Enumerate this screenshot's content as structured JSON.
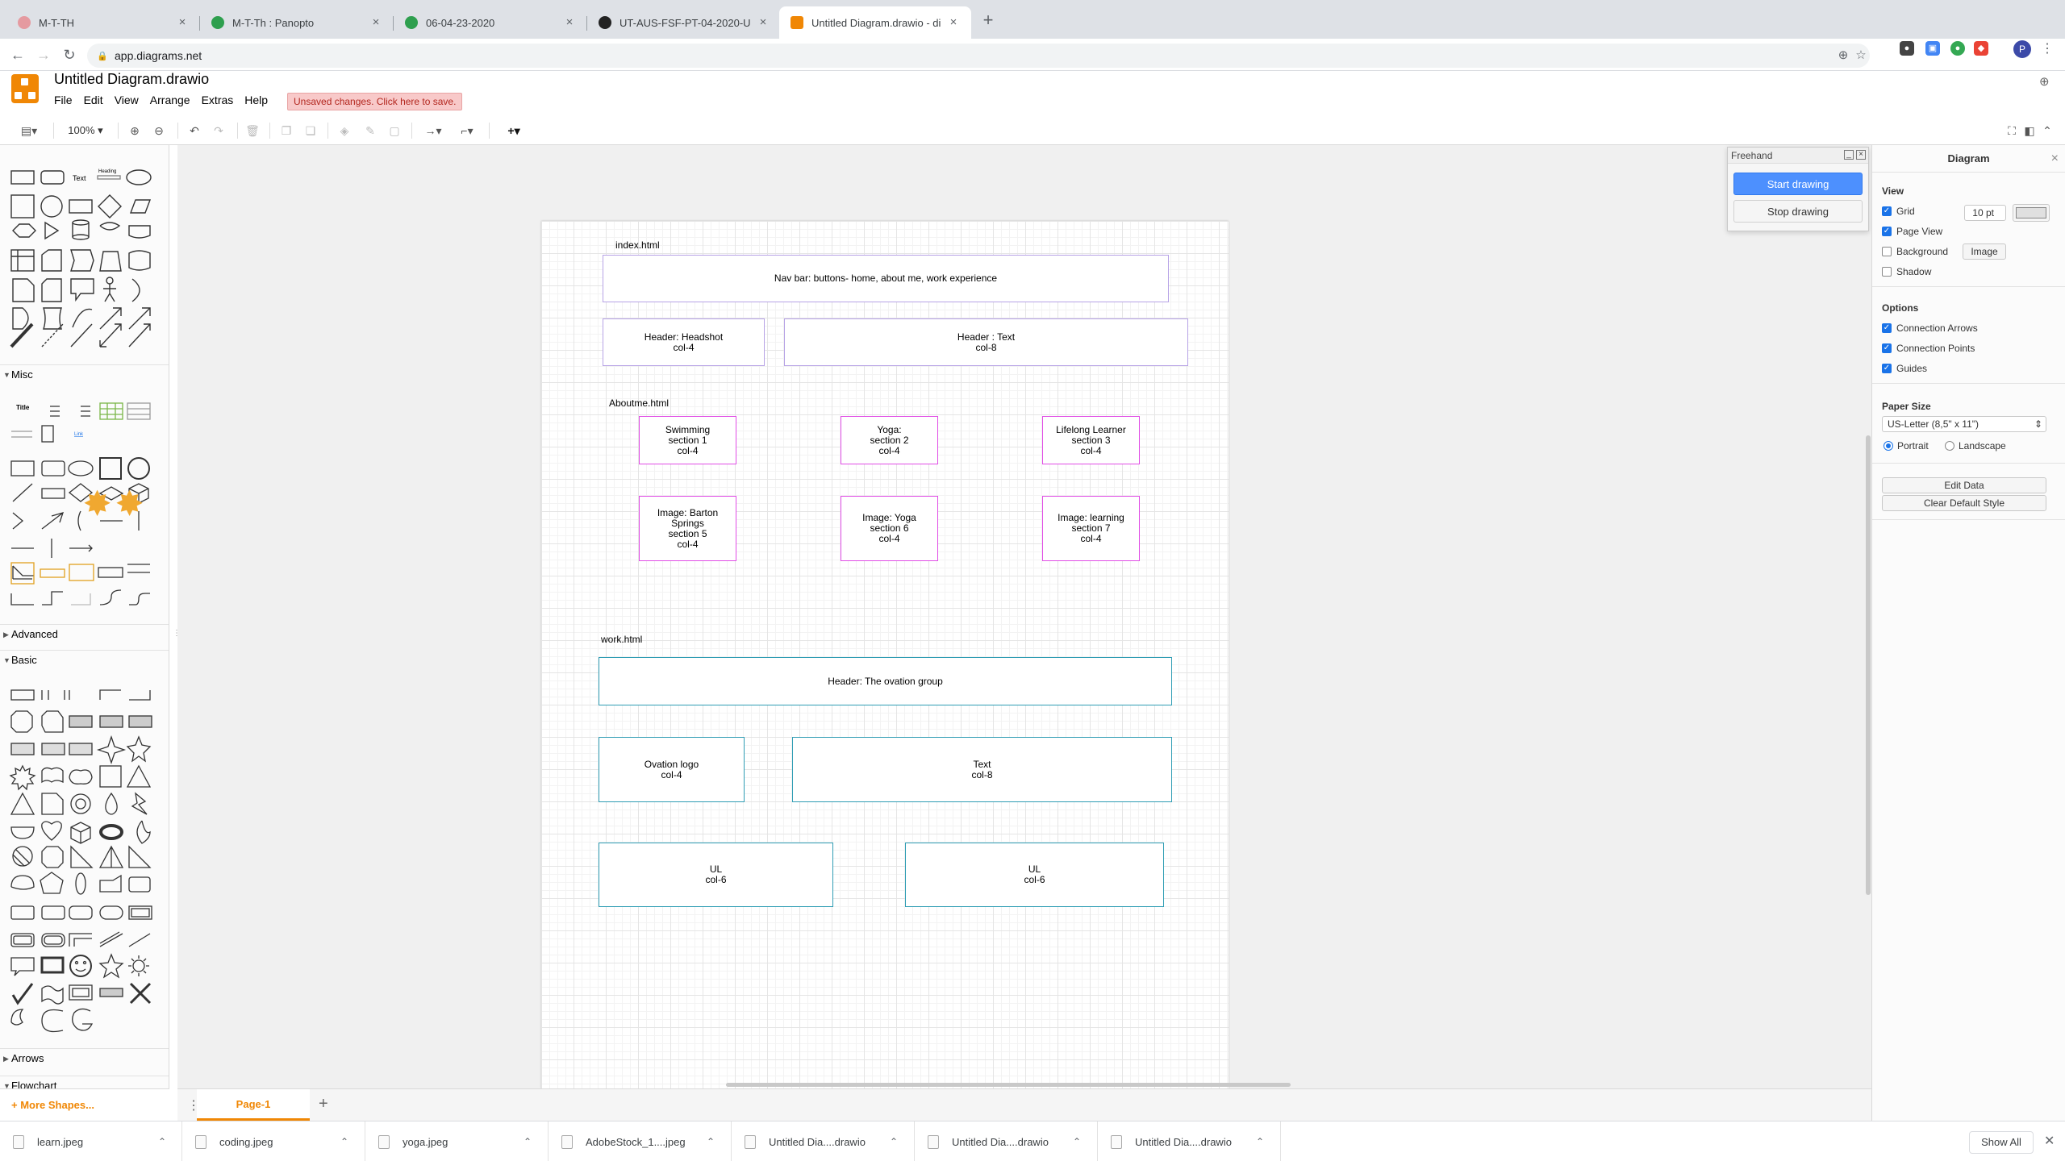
{
  "browser": {
    "tabs": [
      {
        "title": "M-T-TH",
        "favicon_color": "#e59aa0"
      },
      {
        "title": "M-T-Th : Panopto",
        "favicon_color": "#2e9f4e"
      },
      {
        "title": "06-04-23-2020",
        "favicon_color": "#2e9f4e"
      },
      {
        "title": "UT-AUS-FSF-PT-04-2020-U",
        "favicon_color": "#222222"
      },
      {
        "title": "Untitled Diagram.drawio - diag",
        "favicon_color": "#f08705"
      }
    ],
    "url": "app.diagrams.net"
  },
  "app": {
    "title": "Untitled Diagram.drawio",
    "menu": [
      "File",
      "Edit",
      "View",
      "Arrange",
      "Extras",
      "Help"
    ],
    "unsaved": "Unsaved changes. Click here to save.",
    "zoom": "100%"
  },
  "sidebar": {
    "sections": {
      "misc": "Misc",
      "advanced": "Advanced",
      "basic": "Basic",
      "arrows": "Arrows",
      "flowchart": "Flowchart"
    },
    "general_labels": {
      "text": "Text",
      "heading": "Heading"
    },
    "misc_labels": {
      "title": "Title",
      "link": "Link"
    },
    "more_shapes": "+ More Shapes..."
  },
  "diagram": {
    "labels": {
      "index": "index.html",
      "aboutme": "Aboutme.html",
      "work": "work.html"
    },
    "boxes": {
      "navbar": "Nav bar: buttons- home, about me, work experience",
      "header_headshot": "Header: Headshot\ncol-4",
      "header_text": "Header :  Text\ncol-8",
      "swimming": "Swimming\nsection 1\ncol-4",
      "yoga": "Yoga:\nsection 2\ncol-4",
      "lifelong": "Lifelong Learner\nsection 3\ncol-4",
      "image_barton": "Image: Barton\nSprings\nsection 5\ncol-4",
      "image_yoga": "Image: Yoga\nsection 6\ncol-4",
      "image_learning": "Image: learning\nsection 7\ncol-4",
      "header_ovation": "Header: The ovation group",
      "ovation_logo": "Ovation logo\ncol-4",
      "work_text": "Text\ncol-8",
      "ul_left": "UL\ncol-6",
      "ul_right": "UL\ncol-6"
    },
    "colors": {
      "navbar_group": "#b7a3e6",
      "aboutme_group": "#e14de6",
      "work_group": "#2f9db4"
    }
  },
  "freehand": {
    "title": "Freehand",
    "start": "Start drawing",
    "stop": "Stop drawing"
  },
  "format": {
    "title": "Diagram",
    "view_heading": "View",
    "grid": "Grid",
    "grid_size": "10 pt",
    "page_view": "Page View",
    "background": "Background",
    "image_btn": "Image",
    "shadow": "Shadow",
    "options_heading": "Options",
    "connection_arrows": "Connection Arrows",
    "connection_points": "Connection Points",
    "guides": "Guides",
    "paper_size_heading": "Paper Size",
    "paper_size": "US-Letter (8,5\" x 11\")",
    "portrait": "Portrait",
    "landscape": "Landscape",
    "edit_data": "Edit Data",
    "clear_style": "Clear Default Style"
  },
  "pages": {
    "current": "Page-1"
  },
  "downloads": {
    "items": [
      "learn.jpeg",
      "coding.jpeg",
      "yoga.jpeg",
      "AdobeStock_1....jpeg",
      "Untitled Dia....drawio",
      "Untitled Dia....drawio",
      "Untitled Dia....drawio"
    ],
    "show_all": "Show All"
  }
}
